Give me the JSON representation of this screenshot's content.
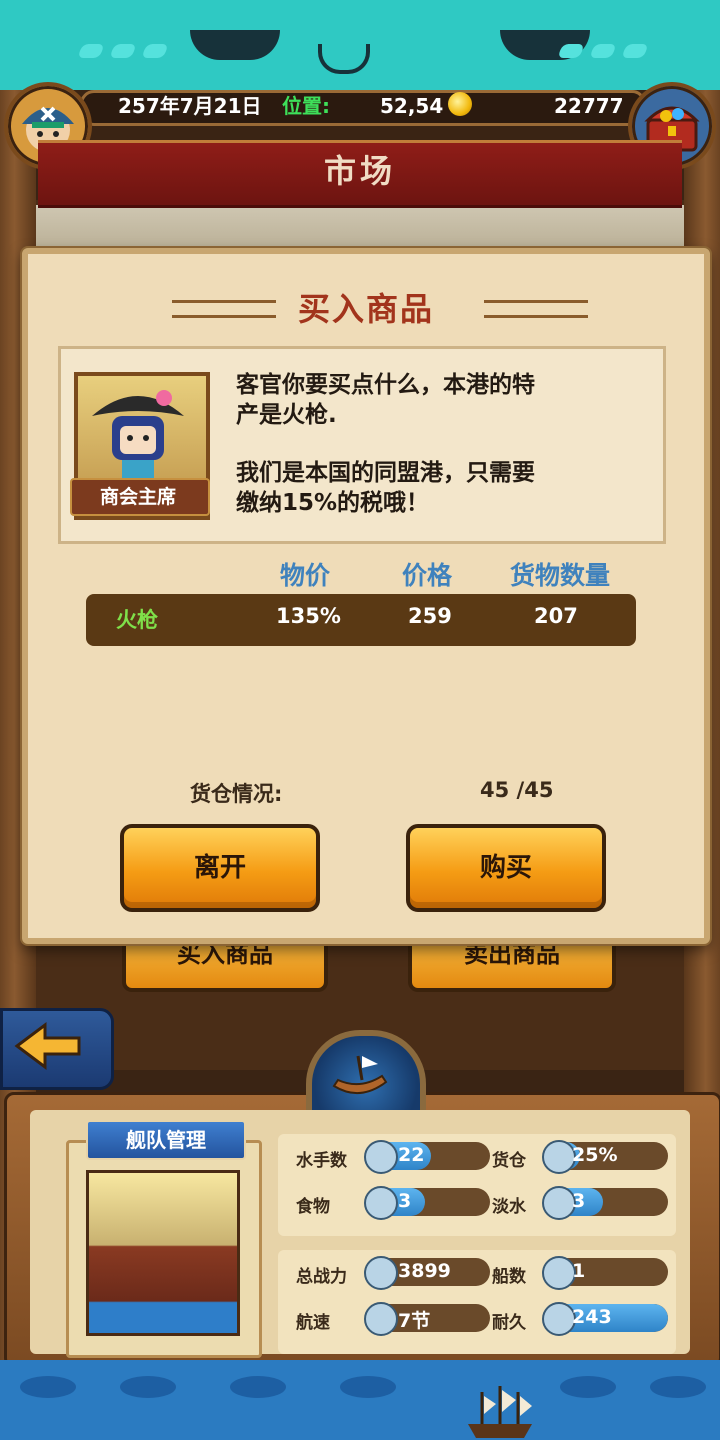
{
  "header": {
    "date": "257年7月21日",
    "position_label": "位置:",
    "position_value": "52,54",
    "gold": "22777"
  },
  "market": {
    "title": "市场"
  },
  "dialog": {
    "title": "买入商品",
    "npc_role": "商会主席",
    "npc_text_line1": "客官你要买点什么，本港的特",
    "npc_text_line2": "产是火枪.",
    "npc_text_line3": "我们是本国的同盟港，只需要",
    "npc_text_line4": "缴纳15%的税哦！",
    "columns": [
      "物价",
      "价格",
      "货物数量"
    ],
    "goods": {
      "name": "火枪",
      "price_index": "135%",
      "price": "259",
      "quantity": "207"
    },
    "cargo_label": "货仓情况:",
    "cargo_value": "45 /45",
    "leave_label": "离开",
    "buy_label": "购买"
  },
  "background_buttons": {
    "buy_goods": "买入商品",
    "sell_goods": "卖出商品"
  },
  "fleet": {
    "title": "舰队管理",
    "stats": [
      {
        "label": "水手数",
        "value": "22",
        "fill": 0.5,
        "icon": "sailor-icon"
      },
      {
        "label": "货仓",
        "value": "25%",
        "fill": 0.25,
        "icon": "crate-icon"
      },
      {
        "label": "食物",
        "value": "3",
        "fill": 0.45,
        "icon": "meat-icon"
      },
      {
        "label": "淡水",
        "value": "3",
        "fill": 0.45,
        "icon": "water-jug-icon"
      },
      {
        "label": "总战力",
        "value": "3899",
        "fill": 0,
        "icon": "crossed-swords-icon"
      },
      {
        "label": "船数",
        "value": "1",
        "fill": 0,
        "icon": "boat-icon"
      },
      {
        "label": "航速",
        "value": "7节",
        "fill": 0,
        "icon": "ship-speed-icon"
      },
      {
        "label": "耐久",
        "value": "243",
        "fill": 1.0,
        "icon": "durability-icon"
      }
    ]
  },
  "colors": {
    "accent_blue": "#3f82bd",
    "title_red": "#a2341c",
    "parchment": "#efdcb8",
    "button_gold": "#f59c14",
    "position_green": "#3ee05a",
    "goods_green": "#7fe04a"
  }
}
